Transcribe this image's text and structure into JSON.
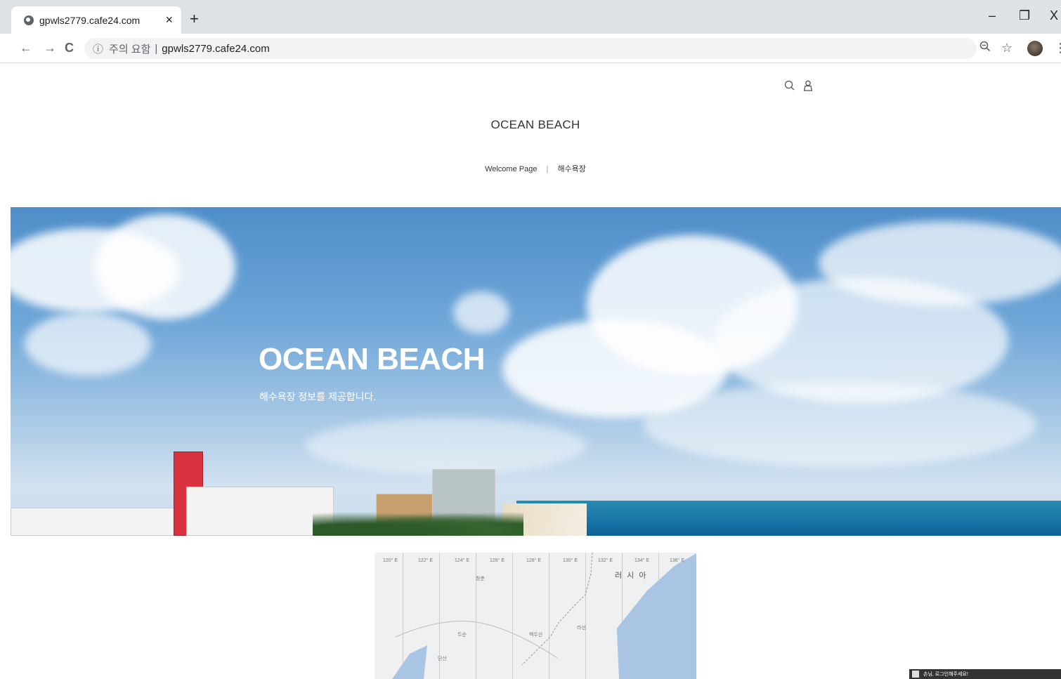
{
  "browser": {
    "tab_title": "gpwls2779.cafe24.com",
    "tab_close": "×",
    "new_tab": "+",
    "security_icon": "info-icon",
    "security_label": "주의 요함",
    "url": "gpwls2779.cafe24.com",
    "back": "←",
    "forward": "→",
    "reload": "C",
    "zoom": "zoom-icon",
    "star": "☆",
    "menu": "⋮",
    "minimize": "–",
    "restore": "❐",
    "close": "X"
  },
  "header": {
    "search_icon": "search-icon",
    "user_icon": "user-icon",
    "site_title": "OCEAN BEACH",
    "nav": [
      "Welcome Page",
      "해수욕장"
    ],
    "nav_separator": "|"
  },
  "hero": {
    "title": "OCEAN BEACH",
    "subtitle": "해수욕장 정보를 제공합니다."
  },
  "map": {
    "country_label": "러 시 아",
    "place_labels": [
      "창춘",
      "두순",
      "백두산",
      "라선",
      "단산"
    ],
    "longitude_labels": [
      "120° E",
      "122° E",
      "124° E",
      "126° E",
      "128° E",
      "130° E",
      "132° E",
      "134° E",
      "136° E"
    ]
  },
  "chat_widget": {
    "label": "손님, 로그인해주세요!"
  }
}
